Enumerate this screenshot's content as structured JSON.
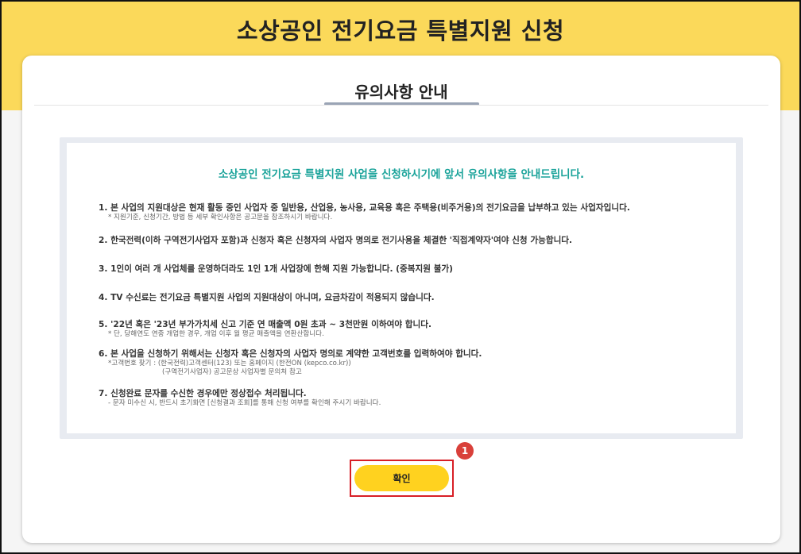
{
  "app": {
    "title": "소상공인 전기요금 특별지원 신청"
  },
  "card": {
    "section_title": "유의사항 안내"
  },
  "notice": {
    "heading": "소상공인 전기요금 특별지원 사업을 신청하시기에 앞서 유의사항을 안내드립니다.",
    "items": [
      {
        "text": "1. 본 사업의 지원대상은 현재 활동 중인 사업자 중 일반용, 산업용, 농사용, 교육용 혹은 주택용(비주거용)의 전기요금을 납부하고 있는 사업자입니다.",
        "subs": [
          "* 지원기준, 신청기간, 방법 등 세부 확인사항은 공고문을 참조하시기 바랍니다."
        ]
      },
      {
        "text": "2. 한국전력(이하 구역전기사업자 포함)과 신청자 혹은 신청자의 사업자 명의로 전기사용을 체결한 '직접계약자'여야 신청 가능합니다.",
        "subs": []
      },
      {
        "text": "3. 1인이 여러 개 사업체를 운영하더라도 1인 1개 사업장에 한해 지원 가능합니다. (중복지원 불가)",
        "subs": []
      },
      {
        "text": "4. TV 수신료는 전기요금 특별지원 사업의 지원대상이 아니며, 요금차감이 적용되지 않습니다.",
        "subs": []
      },
      {
        "text": "5. '22년 혹은 '23년 부가가치세 신고 기준 연 매출액 0원 초과 ~ 3천만원 이하여야 합니다.",
        "subs": [
          "* 단, 당해연도 연중 개업한 경우, 개업 이후 월 평균 매출액을 연환산합니다."
        ]
      },
      {
        "text": "6. 본 사업을 신청하기 위해서는 신청자 혹은 신청자의 사업자 명의로 계약한 고객번호를 입력하여야 합니다.",
        "subs": [
          "*고객번호 찾기 : (한국전력)고객센터(123) 또는 홈페이지 (한전ON (kepco.co.kr))",
          "(구역전기사업자) 공고문상 사업자별 문의처 참고"
        ]
      },
      {
        "text": "7. 신청완료 문자를 수신한 경우에만 정상접수 처리됩니다.",
        "subs": [
          "- 문자 미수신 시, 반드시 초기화면 [신청결과 조회]를 통해 신청 여부를 확인해 주시기 바랍니다."
        ]
      }
    ]
  },
  "actions": {
    "confirm_label": "확인",
    "step_badge": "1"
  }
}
